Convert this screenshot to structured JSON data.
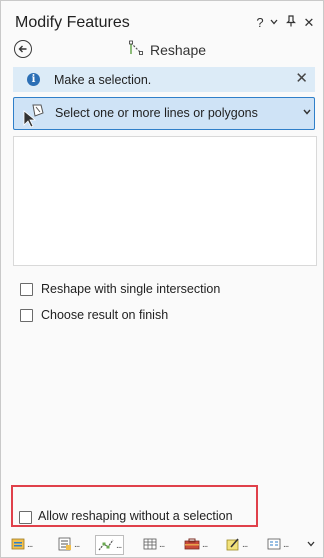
{
  "pane": {
    "title": "Modify Features",
    "controls": {
      "help": "?",
      "menu": "⌄",
      "pin": "📌",
      "close": "✕"
    }
  },
  "tool": {
    "back_icon": "back-arrow-icon",
    "title": "Reshape",
    "icon": "reshape-icon"
  },
  "message": {
    "text": "Make a selection.",
    "icon": "info-icon",
    "close": "✕"
  },
  "selector": {
    "label": "Select one or more lines or polygons",
    "icon": "select-lines-icon"
  },
  "options": [
    {
      "label": "Reshape with single intersection",
      "checked": false
    },
    {
      "label": "Choose result on finish",
      "checked": false
    }
  ],
  "bottom_option": {
    "label": "Allow reshaping without a selection",
    "checked": false,
    "highlight_color": "#e0404a"
  },
  "bottom_tabs": {
    "items": [
      "catalog-icon",
      "attributes-icon",
      "modify-features-icon",
      "table-icon",
      "toolbox-icon",
      "edit-icon",
      "contents-icon"
    ],
    "overflow": "⌄"
  },
  "colors": {
    "accent": "#2f7fc9",
    "selector_bg": "#cfe3f6",
    "message_bg": "#dcebf7"
  }
}
